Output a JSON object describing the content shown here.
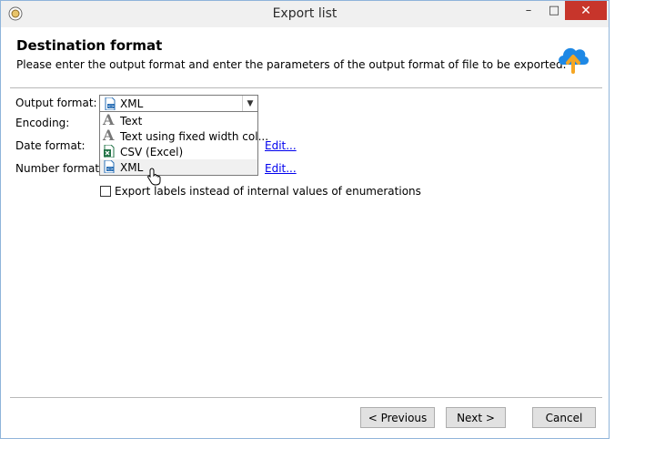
{
  "window": {
    "title": "Export list",
    "minimize_glyph": "–",
    "maximize_glyph": "□",
    "close_glyph": "✕"
  },
  "header": {
    "title": "Destination format",
    "subtitle": "Please enter the output format and enter the parameters of the output format of file to be exported.",
    "icon": "cloud-upload-icon"
  },
  "form": {
    "output_format_label": "Output format:",
    "encoding_label": "Encoding:",
    "date_format_label": "Date format:",
    "number_format_label": "Number format:",
    "output_format_value": "XML",
    "date_edit_link": "Edit...",
    "number_edit_link": "Edit...",
    "export_labels_text": "Export labels instead of internal values of enumerations"
  },
  "dropdown": {
    "options": [
      {
        "label": "Text",
        "icon": "text-icon"
      },
      {
        "label": "Text using fixed width col...",
        "icon": "text-icon"
      },
      {
        "label": "CSV (Excel)",
        "icon": "excel-icon"
      },
      {
        "label": "XML",
        "icon": "xml-icon"
      }
    ],
    "selected": "XML"
  },
  "footer": {
    "previous_label": "< Previous",
    "next_label": "Next >",
    "cancel_label": "Cancel"
  },
  "colors": {
    "close_button": "#c7352b",
    "cloud_blue": "#1e88e5",
    "arrow_orange": "#f5a623",
    "link": "#0000ee"
  }
}
